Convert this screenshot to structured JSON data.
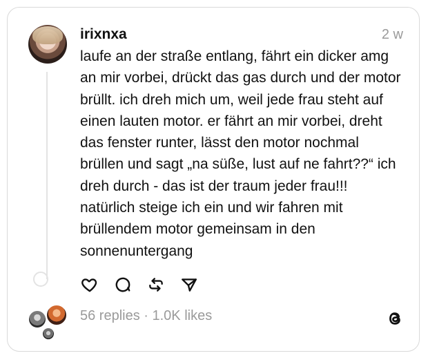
{
  "post": {
    "username": "irixnxa",
    "time": "2 w",
    "text": "laufe an der straße entlang, fährt ein dicker amg an mir vorbei, drückt das gas durch und der motor brüllt. ich dreh mich um, weil jede frau steht auf einen lauten motor. er fährt an mir vorbei, dreht das fenster runter, lässt den motor nochmal brüllen und sagt „na süße, lust auf ne fahrt??“ ich dreh durch - das ist der traum jeder frau!!! natürlich steige ich ein und wir fahren mit brüllendem motor gemeinsam in den sonnenuntergang",
    "stats": "56 replies · 1.0K likes"
  },
  "icons": {
    "like": "heart-icon",
    "reply": "comment-icon",
    "repost": "repost-icon",
    "share": "send-icon",
    "brand": "threads-logo-icon"
  },
  "colors": {
    "text": "#111111",
    "muted": "#9a9a9a",
    "border": "#d9d9d9",
    "thread_line": "#e3e3e3"
  }
}
